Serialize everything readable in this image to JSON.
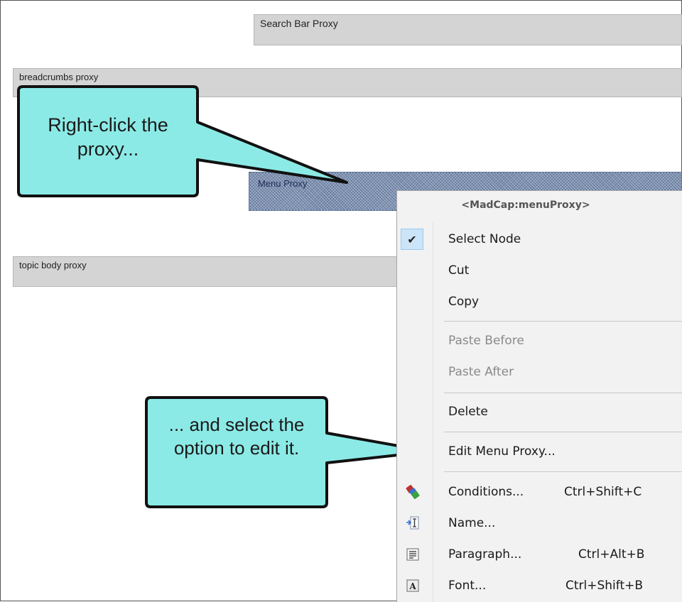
{
  "proxies": {
    "search_bar": "Search Bar Proxy",
    "breadcrumbs": "breadcrumbs proxy",
    "menu": "Menu Proxy",
    "topic_body": "topic body proxy"
  },
  "callouts": {
    "first": "Right-click the proxy...",
    "second": "... and select the option to edit it."
  },
  "context_menu": {
    "header": "<MadCap:menuProxy>",
    "items": [
      {
        "label": "Select Node",
        "checked": true,
        "enabled": true
      },
      {
        "label": "Cut",
        "enabled": true
      },
      {
        "label": "Copy",
        "enabled": true
      },
      {
        "label": "Paste Before",
        "enabled": false
      },
      {
        "label": "Paste After",
        "enabled": false
      },
      {
        "label": "Delete",
        "enabled": true
      },
      {
        "label": "Edit Menu Proxy...",
        "enabled": true
      },
      {
        "label": "Conditions...",
        "shortcut": "Ctrl+Shift+C",
        "icon": "conditions-icon",
        "enabled": true
      },
      {
        "label": "Name...",
        "icon": "name-icon",
        "enabled": true
      },
      {
        "label": "Paragraph...",
        "shortcut": "Ctrl+Alt+B",
        "icon": "paragraph-icon",
        "enabled": true
      },
      {
        "label": "Font...",
        "shortcut": "Ctrl+Shift+B",
        "icon": "font-icon",
        "enabled": true
      }
    ]
  },
  "colors": {
    "callout_fill": "#8ceae6",
    "menu_background": "#f2f2f2",
    "selection_highlight": "#cce4f7",
    "proxy_gray": "#d4d4d4"
  }
}
